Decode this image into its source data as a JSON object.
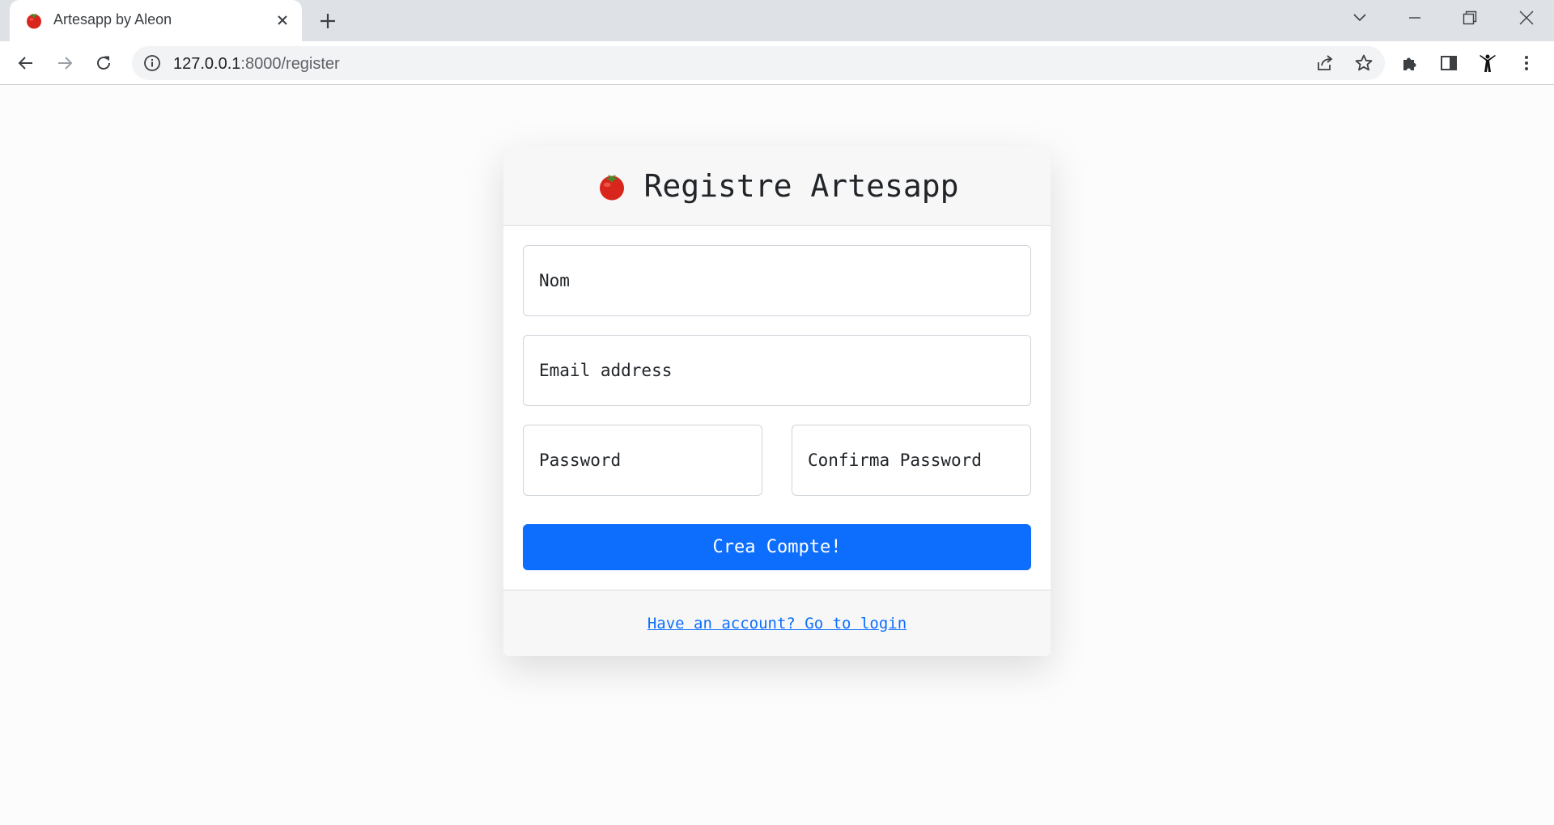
{
  "browser": {
    "tab": {
      "title": "Artesapp by Aleon",
      "favicon": "tomato-icon"
    },
    "address": {
      "host": "127.0.0.1",
      "path": ":8000/register"
    }
  },
  "page": {
    "title": "Registre Artesapp",
    "fields": {
      "name_placeholder": "Nom",
      "email_placeholder": "Email address",
      "password_placeholder": "Password",
      "confirm_placeholder": "Confirma Password"
    },
    "submit_label": "Crea Compte!",
    "login_link": "Have an account? Go to login"
  },
  "colors": {
    "primary": "#0d6efd",
    "tomato": "#d9261c"
  }
}
